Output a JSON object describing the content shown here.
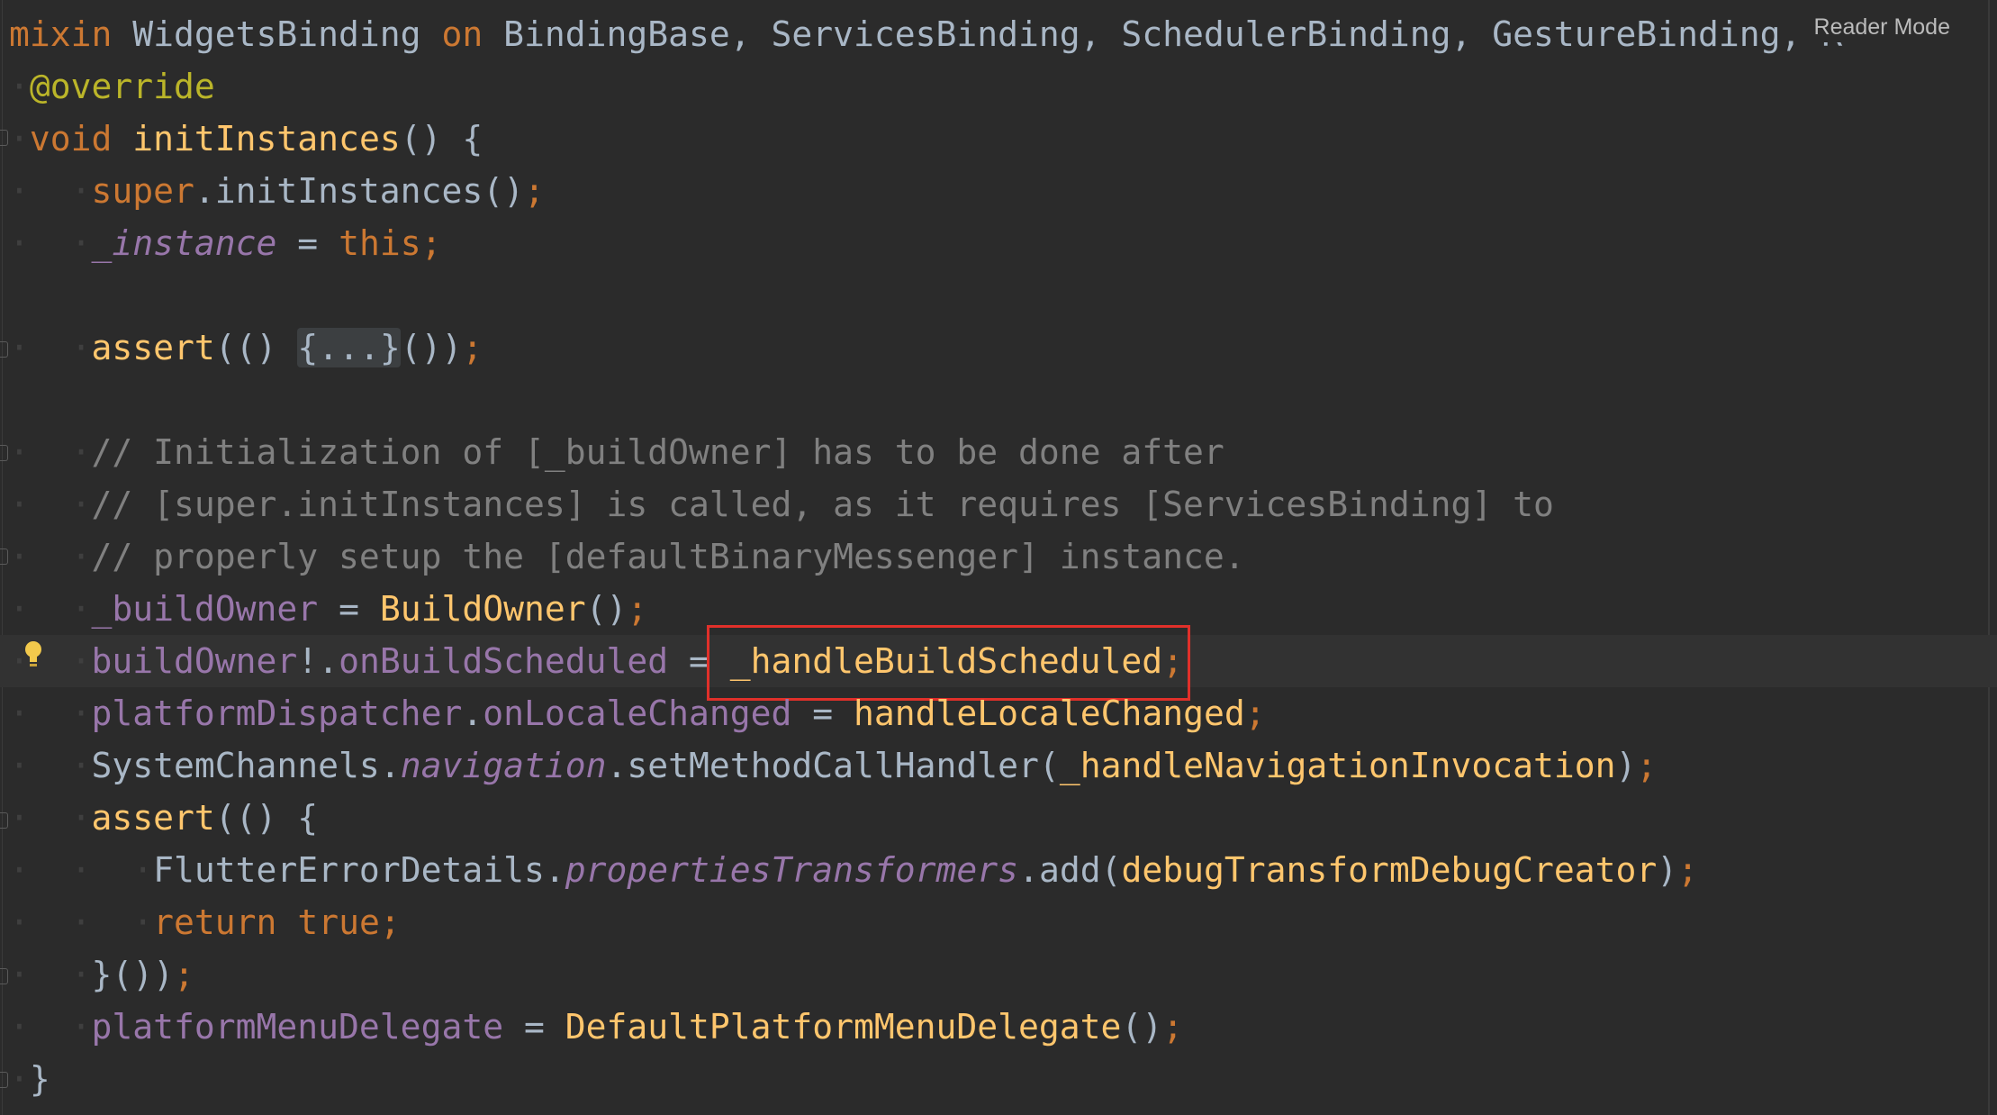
{
  "toolbar": {
    "reader_mode": "Reader Mode"
  },
  "code": {
    "line1": {
      "mixin": "mixin",
      "name": " WidgetsBinding ",
      "on": "on",
      "bases": " BindingBase, ServicesBinding, SchedulerBinding, GestureBinding, R"
    },
    "line2": {
      "annotation": "@override"
    },
    "line3": {
      "void": "void ",
      "method": "initInstances",
      "rest": "() {"
    },
    "line4": {
      "super": "super",
      "rest": ".initInstances()",
      "semi": ";"
    },
    "line5": {
      "field": "_instance",
      "eq": " = ",
      "this": "this",
      "semi": ";"
    },
    "line7": {
      "assert": "assert",
      "open": "(() ",
      "folded": "{...}",
      "close": "())",
      "semi": ";"
    },
    "line9": {
      "comment": "// Initialization of [_buildOwner] has to be done after"
    },
    "line10": {
      "comment": "// [super.initInstances] is called, as it requires [ServicesBinding] to"
    },
    "line11": {
      "comment": "// properly setup the [defaultBinaryMessenger] instance."
    },
    "line12": {
      "field": "_buildOwner",
      "eq": " = ",
      "ctor": "BuildOwner",
      "paren": "()",
      "semi": ";"
    },
    "line13": {
      "field1": "buildOwner",
      "bang": "!.",
      "field2": "onBuildScheduled",
      "eq": " = ",
      "handler": "_handleBuildScheduled",
      "semi": ";"
    },
    "line14": {
      "field1": "platformDispatcher",
      "dot": ".",
      "field2": "onLocaleChanged",
      "eq": " = ",
      "handler": "handleLocaleChanged",
      "semi": ";"
    },
    "line15": {
      "cls": "SystemChannels",
      "dot": ".",
      "field": "navigation",
      "call": ".setMethodCallHandler(",
      "handler": "_handleNavigationInvocation",
      "close": ")",
      "semi": ";"
    },
    "line16": {
      "assert": "assert",
      "rest": "(() {"
    },
    "line17": {
      "cls": "FlutterErrorDetails",
      "dot": ".",
      "field": "propertiesTransformers",
      "call": ".add(",
      "handler": "debugTransformDebugCreator",
      "close": ")",
      "semi": ";"
    },
    "line18": {
      "return": "return ",
      "true": "true",
      "semi": ";"
    },
    "line19": {
      "close": "}())",
      "semi": ";"
    },
    "line20": {
      "field": "platformMenuDelegate",
      "eq": " = ",
      "ctor": "DefaultPlatformMenuDelegate",
      "paren": "()",
      "semi": ";"
    },
    "line21": {
      "close": "}"
    }
  }
}
